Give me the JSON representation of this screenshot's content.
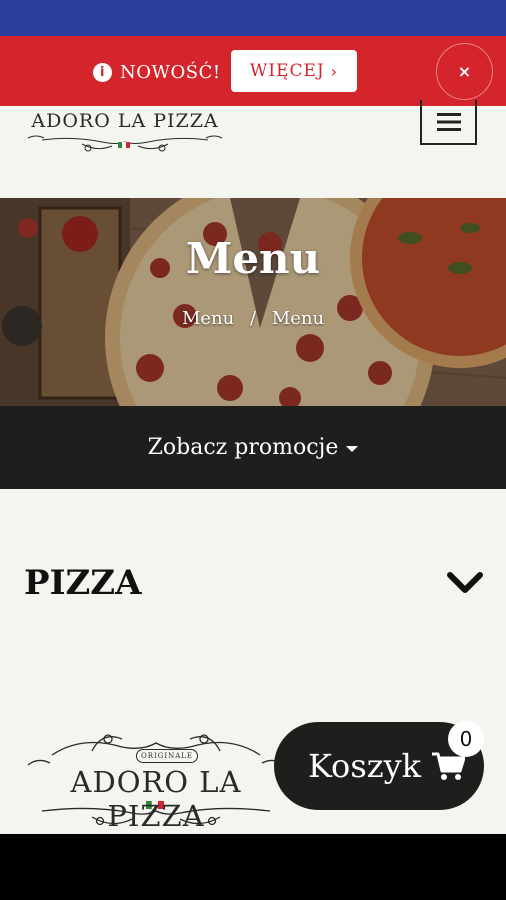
{
  "promo_bar": {
    "message": "NOWOŚĆ!",
    "more_label": "WIĘCEJ",
    "more_chevron": "›",
    "close_label": "×"
  },
  "header": {
    "logo_text": "ADORO LA PIZZA",
    "menu_icon": "hamburger-icon"
  },
  "hero": {
    "title": "Menu",
    "breadcrumb": [
      {
        "label": "Menu"
      },
      {
        "label": "Menu"
      }
    ],
    "breadcrumb_separator": "/"
  },
  "promo_toggle": {
    "label": "Zobacz promocje"
  },
  "category": {
    "title": "PIZZA",
    "expanded": false
  },
  "footer_logo": {
    "text": "ADORO LA PIZZA",
    "subtext": "ORIGINALE"
  },
  "cart": {
    "label": "Koszyk",
    "count": "0"
  },
  "colors": {
    "status_bar": "#2c3e9a",
    "promo_red": "#d3252b",
    "dark": "#1e1e1c",
    "page_bg": "#f5f5f0"
  }
}
